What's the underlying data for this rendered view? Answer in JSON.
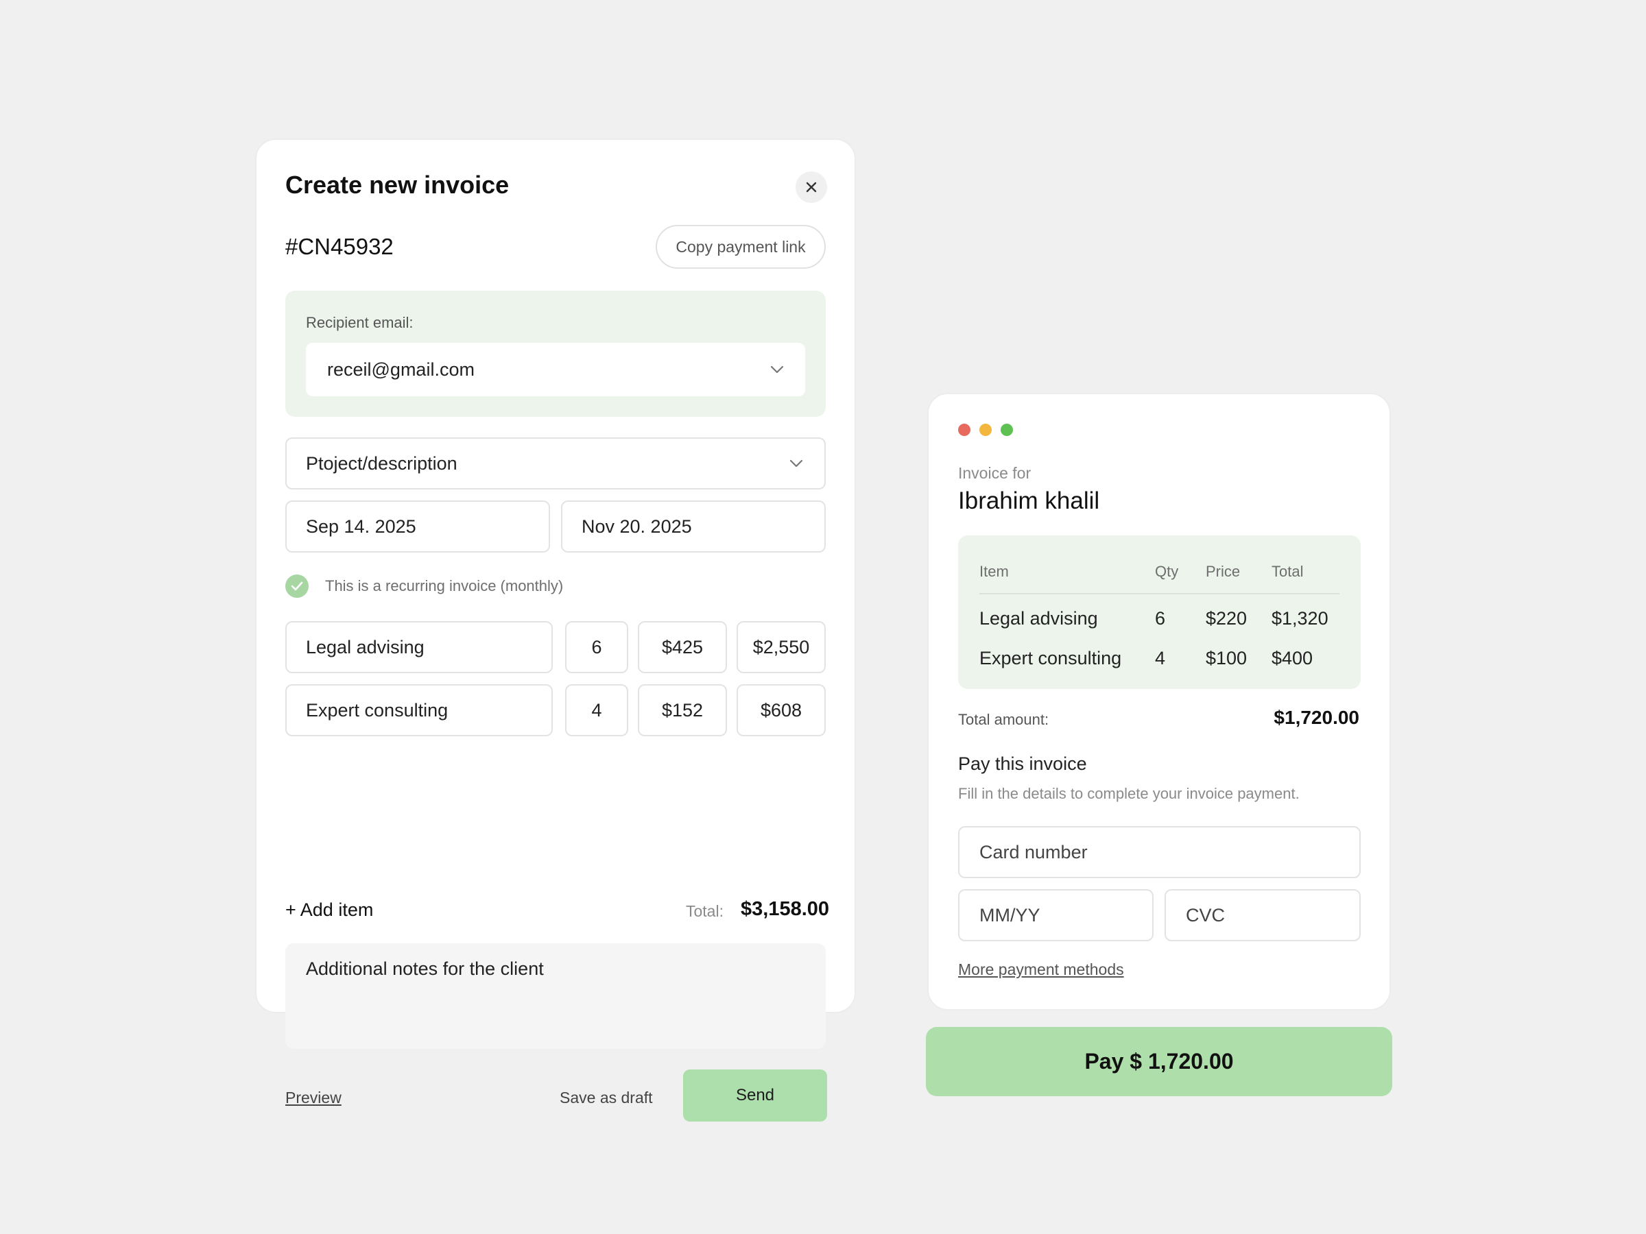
{
  "create_invoice": {
    "title": "Create new invoice",
    "invoice_number": "#CN45932",
    "copy_link_label": "Copy payment link",
    "recipient_label": "Recipient email:",
    "recipient_email": "receil@gmail.com",
    "project_placeholder": "Ptoject/description",
    "start_date": "Sep 14. 2025",
    "end_date": "Nov 20. 2025",
    "recurring_label": "This is a recurring invoice (monthly)",
    "items": [
      {
        "name": "Legal advising",
        "qty": "6",
        "price": "$425",
        "total": "$2,550"
      },
      {
        "name": "Expert consulting",
        "qty": "4",
        "price": "$152",
        "total": "$608"
      }
    ],
    "add_item_label": "+ Add item",
    "total_label": "Total:",
    "total_value": "$3,158.00",
    "notes_placeholder": "Additional notes for the client",
    "preview_label": "Preview",
    "save_draft_label": "Save as draft",
    "send_label": "Send"
  },
  "pay_invoice": {
    "window_dots": [
      "#e86a5e",
      "#f3b73f",
      "#5ec152"
    ],
    "invoice_for_label": "Invoice for",
    "client_name": "Ibrahim khalil",
    "table_headers": {
      "item": "Item",
      "qty": "Qty",
      "price": "Price",
      "total": "Total"
    },
    "rows": [
      {
        "item": "Legal advising",
        "qty": "6",
        "price": "$220",
        "total": "$1,320"
      },
      {
        "item": "Expert consulting",
        "qty": "4",
        "price": "$100",
        "total": "$400"
      }
    ],
    "total_amount_label": "Total amount:",
    "total_amount_value": "$1,720.00",
    "pay_title": "Pay this invoice",
    "pay_subtitle": "Fill in the details to complete your invoice payment.",
    "card_number_placeholder": "Card number",
    "expiry_placeholder": "MM/YY",
    "cvc_placeholder": "CVC",
    "more_methods_label": "More payment methods",
    "pay_button_label": "Pay $ 1,720.00"
  },
  "colors": {
    "accent_green": "#addfad",
    "panel_green": "#ecf4ec",
    "background": "#f0f0f0"
  }
}
